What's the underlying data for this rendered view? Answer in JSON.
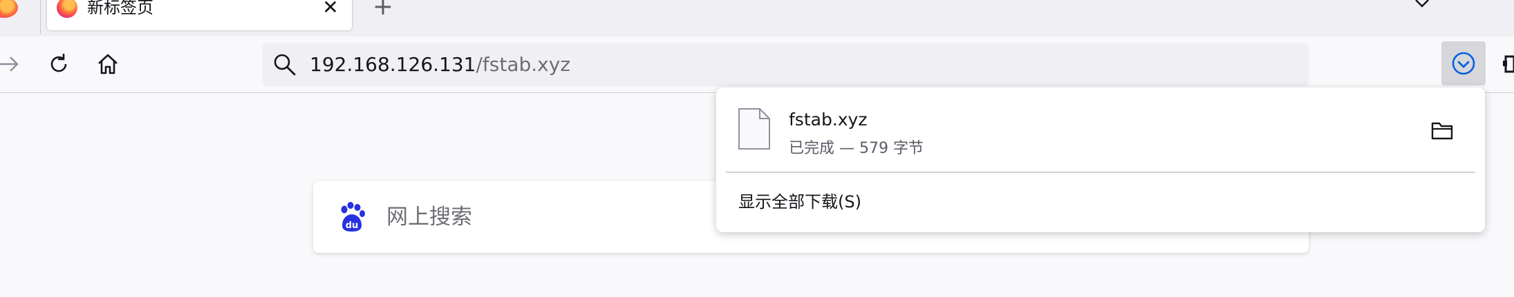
{
  "tabs": {
    "active_title": "新标签页",
    "close_glyph": "✕",
    "new_tab_glyph": "+"
  },
  "icons": {
    "back": "arrow-right-icon",
    "reload": "reload-icon",
    "home": "home-icon",
    "search": "search-icon",
    "downloads": "download-check-icon",
    "folder": "folder-icon",
    "file": "file-icon",
    "baidu": "baidu-paw-icon"
  },
  "urlbar": {
    "host": "192.168.126.131",
    "path": "/fstab.xyz"
  },
  "search": {
    "placeholder": "网上搜索"
  },
  "downloads_panel": {
    "file_name": "fstab.xyz",
    "status": "已完成 — 579 字节",
    "show_all_label": "显示全部下载(S)"
  },
  "colors": {
    "accent_blue": "#0061e0",
    "baidu_blue": "#2932e1",
    "toolbar_bg": "#f9f9fb",
    "tabstrip_bg": "#f0f0f4"
  }
}
